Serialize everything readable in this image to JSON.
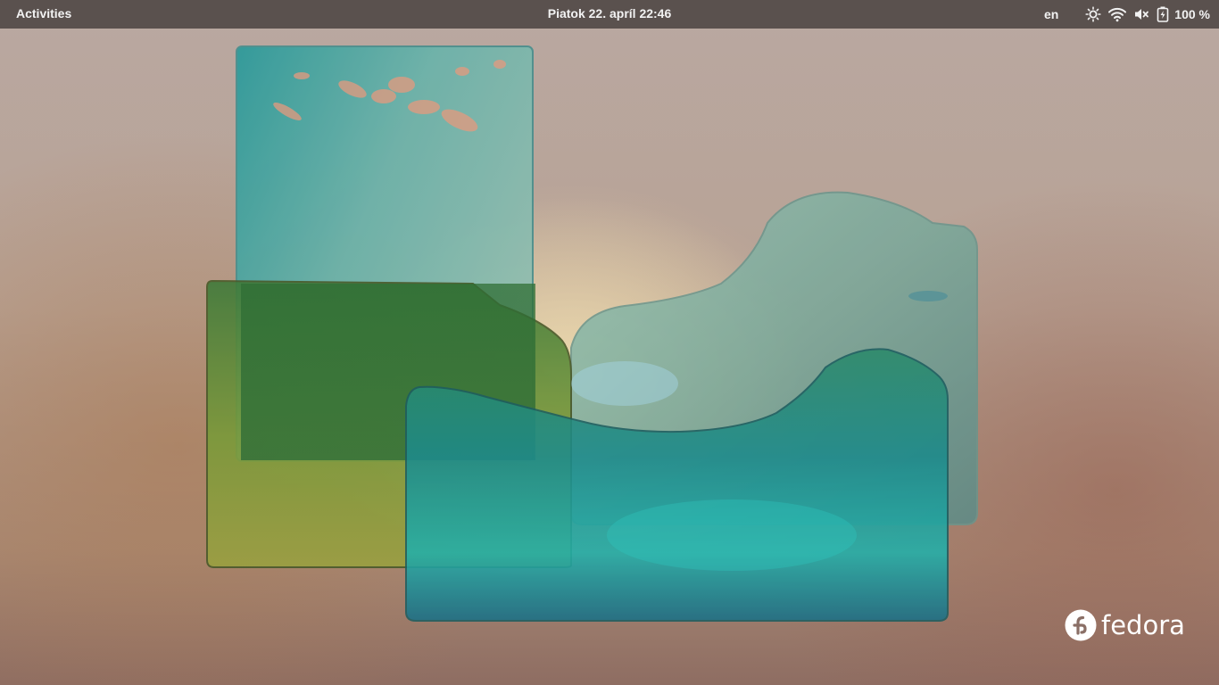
{
  "topbar": {
    "activities_label": "Activities",
    "clock": "Piatok 22. apríl  22:46",
    "keyboard_layout": "en",
    "battery_percent": "100 %",
    "icons": [
      "brightness-icon",
      "wifi-icon",
      "volume-muted-icon",
      "battery-icon"
    ]
  },
  "desktop": {
    "wallpaper_logo_text": "fedora"
  },
  "colors": {
    "topbar_bg": "#463e3c",
    "topbar_text": "#f2f2f2"
  }
}
